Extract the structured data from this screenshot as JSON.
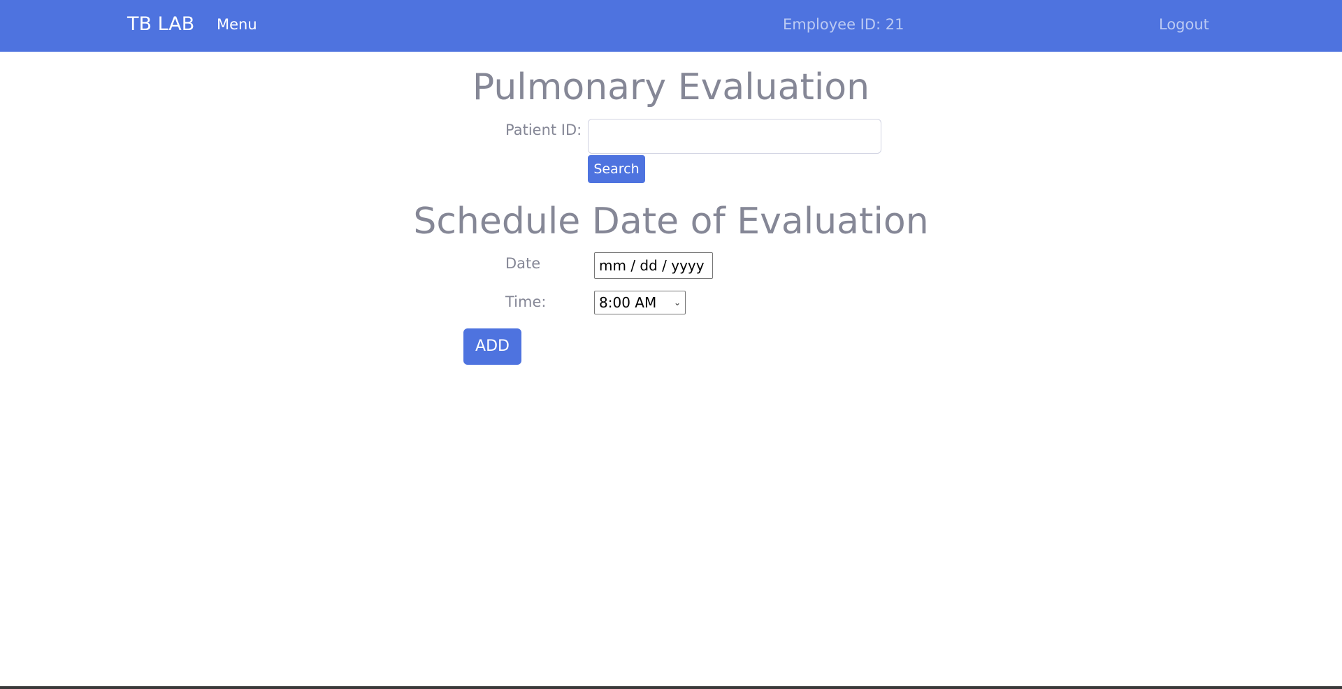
{
  "navbar": {
    "brand": "TB LAB",
    "menu_label": "Menu",
    "employee_id": "Employee ID: 21",
    "logout_label": "Logout"
  },
  "evaluation": {
    "title": "Pulmonary Evaluation",
    "patient_label": "Patient ID:",
    "patient_value": "",
    "search_label": "Search"
  },
  "schedule": {
    "title": "Schedule Date of Evaluation",
    "date_label": "Date",
    "date_placeholder": "mm / dd / yyyy",
    "time_label": "Time:",
    "time_selected": "8:00 AM",
    "add_label": "ADD"
  },
  "colors": {
    "primary": "#4e73df",
    "text_muted": "#858796"
  },
  "icons": {
    "time_dropdown": "chevron-down-icon"
  }
}
